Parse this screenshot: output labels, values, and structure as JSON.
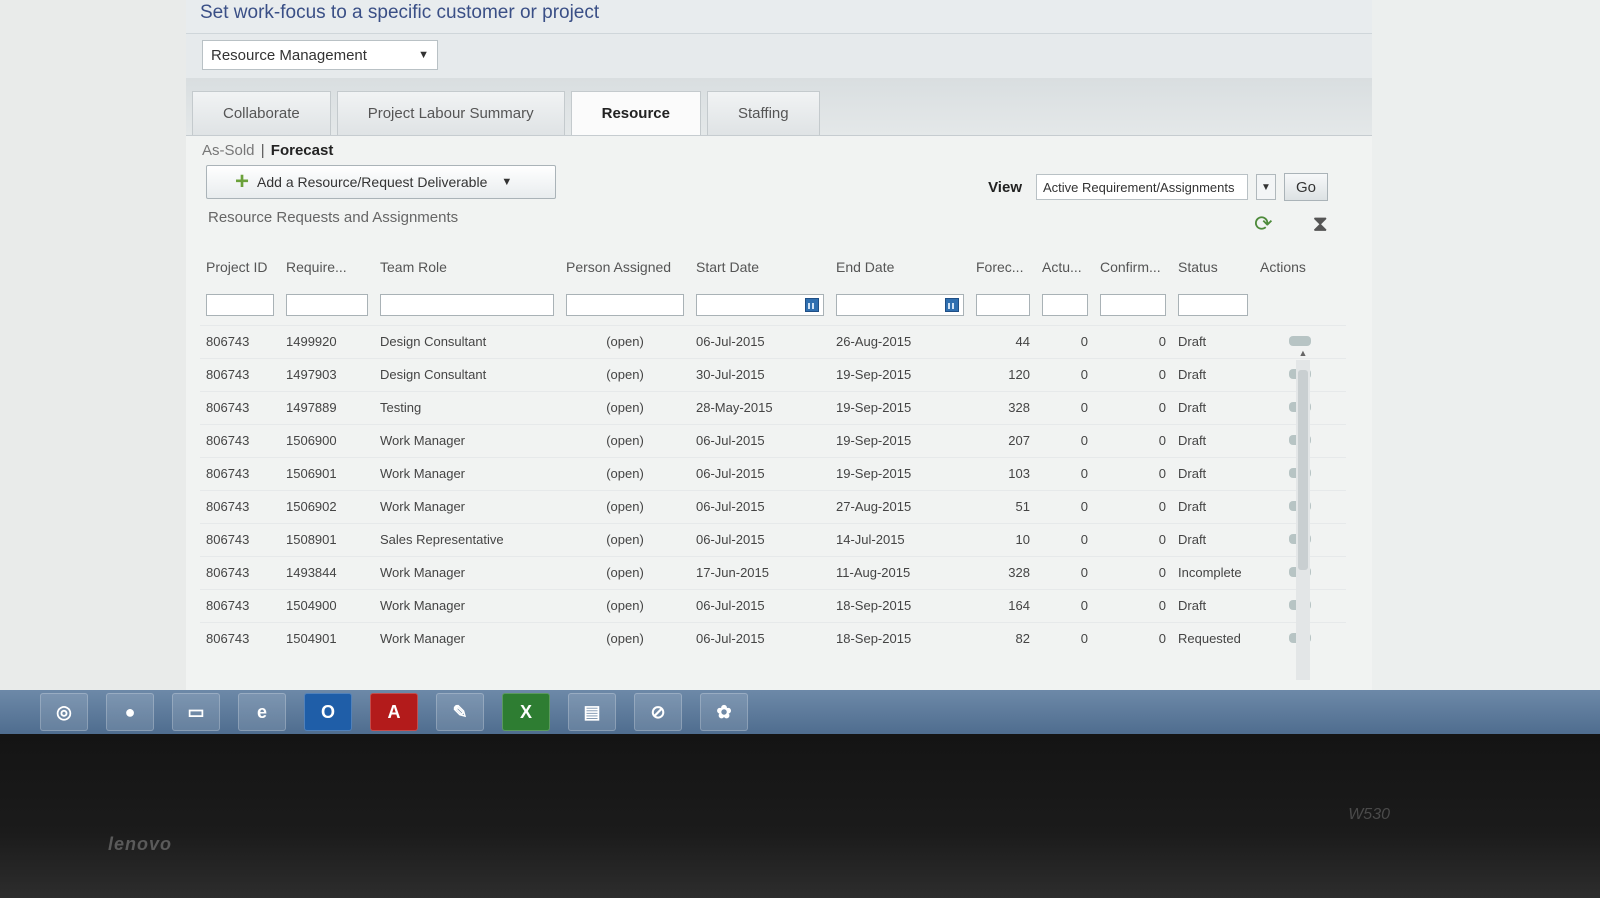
{
  "header": {
    "focus_title": "Set work-focus to a specific customer or project"
  },
  "focus_select": {
    "value": "Resource Management"
  },
  "tabs": [
    {
      "label": "Collaborate",
      "active": false
    },
    {
      "label": "Project Labour Summary",
      "active": false
    },
    {
      "label": "Resource",
      "active": true
    },
    {
      "label": "Staffing",
      "active": false
    }
  ],
  "subnav": {
    "as_sold": "As-Sold",
    "separator": "|",
    "forecast": "Forecast"
  },
  "add_button": {
    "label": "Add a Resource/Request Deliverable",
    "icon": "plus-icon"
  },
  "view": {
    "label": "View",
    "value": "Active Requirement/Assignments",
    "go_label": "Go"
  },
  "section": {
    "title": "Resource Requests and Assignments",
    "icons": [
      "refresh-icon",
      "filter-icon"
    ]
  },
  "table": {
    "headers": [
      "Project ID",
      "Require...",
      "Team Role",
      "Person Assigned",
      "Start Date",
      "End Date",
      "Forec...",
      "Actu...",
      "Confirm...",
      "Status",
      "Actions"
    ],
    "rows": [
      {
        "project_id": "806743",
        "requirement": "1499920",
        "team_role": "Design Consultant",
        "person": "(open)",
        "start": "06-Jul-2015",
        "end": "26-Aug-2015",
        "forecast": "44",
        "actual": "0",
        "confirmed": "0",
        "status": "Draft"
      },
      {
        "project_id": "806743",
        "requirement": "1497903",
        "team_role": "Design Consultant",
        "person": "(open)",
        "start": "30-Jul-2015",
        "end": "19-Sep-2015",
        "forecast": "120",
        "actual": "0",
        "confirmed": "0",
        "status": "Draft"
      },
      {
        "project_id": "806743",
        "requirement": "1497889",
        "team_role": "Testing",
        "person": "(open)",
        "start": "28-May-2015",
        "end": "19-Sep-2015",
        "forecast": "328",
        "actual": "0",
        "confirmed": "0",
        "status": "Draft"
      },
      {
        "project_id": "806743",
        "requirement": "1506900",
        "team_role": "Work Manager",
        "person": "(open)",
        "start": "06-Jul-2015",
        "end": "19-Sep-2015",
        "forecast": "207",
        "actual": "0",
        "confirmed": "0",
        "status": "Draft"
      },
      {
        "project_id": "806743",
        "requirement": "1506901",
        "team_role": "Work Manager",
        "person": "(open)",
        "start": "06-Jul-2015",
        "end": "19-Sep-2015",
        "forecast": "103",
        "actual": "0",
        "confirmed": "0",
        "status": "Draft"
      },
      {
        "project_id": "806743",
        "requirement": "1506902",
        "team_role": "Work Manager",
        "person": "(open)",
        "start": "06-Jul-2015",
        "end": "27-Aug-2015",
        "forecast": "51",
        "actual": "0",
        "confirmed": "0",
        "status": "Draft"
      },
      {
        "project_id": "806743",
        "requirement": "1508901",
        "team_role": "Sales Representative",
        "person": "(open)",
        "start": "06-Jul-2015",
        "end": "14-Jul-2015",
        "forecast": "10",
        "actual": "0",
        "confirmed": "0",
        "status": "Draft"
      },
      {
        "project_id": "806743",
        "requirement": "1493844",
        "team_role": "Work Manager",
        "person": "(open)",
        "start": "17-Jun-2015",
        "end": "11-Aug-2015",
        "forecast": "328",
        "actual": "0",
        "confirmed": "0",
        "status": "Incomplete"
      },
      {
        "project_id": "806743",
        "requirement": "1504900",
        "team_role": "Work Manager",
        "person": "(open)",
        "start": "06-Jul-2015",
        "end": "18-Sep-2015",
        "forecast": "164",
        "actual": "0",
        "confirmed": "0",
        "status": "Draft"
      },
      {
        "project_id": "806743",
        "requirement": "1504901",
        "team_role": "Work Manager",
        "person": "(open)",
        "start": "06-Jul-2015",
        "end": "18-Sep-2015",
        "forecast": "82",
        "actual": "0",
        "confirmed": "0",
        "status": "Requested"
      }
    ]
  },
  "taskbar": {
    "items": [
      {
        "name": "windows-media-icon",
        "glyph": "◎",
        "class": ""
      },
      {
        "name": "firefox-icon",
        "glyph": "●",
        "class": ""
      },
      {
        "name": "folder-icon",
        "glyph": "▭",
        "class": ""
      },
      {
        "name": "ie-icon",
        "glyph": "e",
        "class": ""
      },
      {
        "name": "outlook-icon",
        "glyph": "O",
        "class": "outlook"
      },
      {
        "name": "acrobat-icon",
        "glyph": "A",
        "class": "acrobat"
      },
      {
        "name": "paint-icon",
        "glyph": "✎",
        "class": ""
      },
      {
        "name": "excel-icon",
        "glyph": "X",
        "class": "excel"
      },
      {
        "name": "notepad-icon",
        "glyph": "▤",
        "class": ""
      },
      {
        "name": "no-entry-icon",
        "glyph": "⊘",
        "class": ""
      },
      {
        "name": "turtle-icon",
        "glyph": "✿",
        "class": ""
      }
    ]
  },
  "laptop": {
    "brand": "lenovo",
    "model": "W530"
  }
}
